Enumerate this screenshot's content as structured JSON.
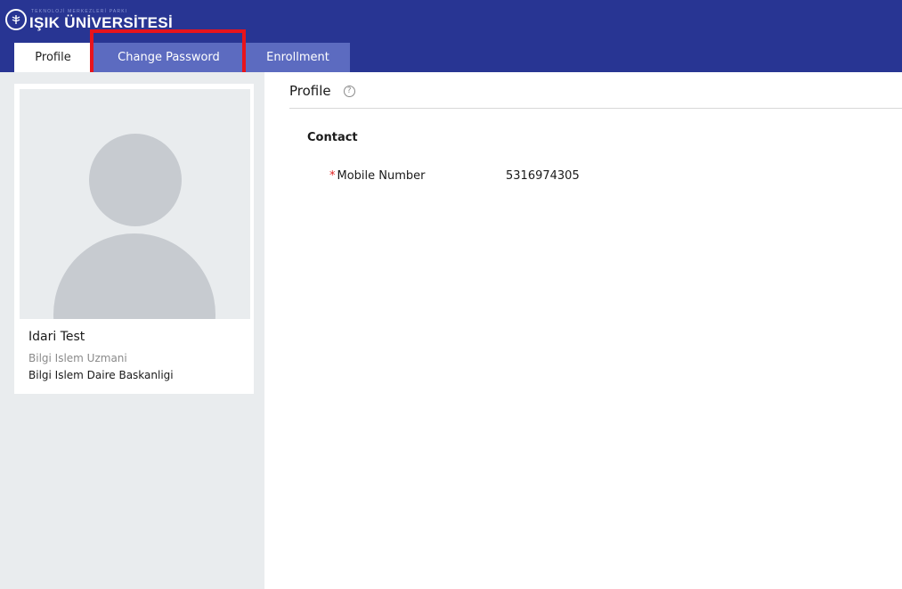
{
  "header": {
    "logo": {
      "tagline": "TEKNOLOJİ MERKEZLERİ PARKI",
      "name": "IŞIK ÜNİVERSİTESİ"
    },
    "background_color": "#283593"
  },
  "tabs": [
    {
      "label": "Profile",
      "active": true
    },
    {
      "label": "Change Password",
      "active": false,
      "highlighted": true
    },
    {
      "label": "Enrollment",
      "active": false
    }
  ],
  "sidebar": {
    "avatar_icon": "user-silhouette",
    "user_name": "Idari Test",
    "user_title": "Bilgi Islem Uzmani",
    "user_department": "Bilgi Islem Daire Baskanligi"
  },
  "main": {
    "page_title": "Profile",
    "help_icon": "question-circle",
    "help_symbol": "?",
    "section_title": "Contact",
    "fields": [
      {
        "required_mark": "*",
        "label": "Mobile Number",
        "value": "5316974305"
      }
    ]
  },
  "colors": {
    "header": "#283593",
    "inactive_tab": "#5c6bc0",
    "highlight_box": "#e8141c",
    "required": "#e02020"
  }
}
